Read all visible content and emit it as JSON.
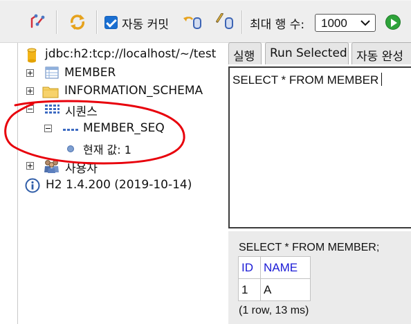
{
  "toolbar": {
    "icons": [
      "plug-icon",
      "refresh-icon",
      "rollback-icon",
      "commit-icon",
      "run-icon"
    ],
    "autocommit_label": "자동 커밋",
    "autocommit_checked": true,
    "max_rows_label": "최대 행 수:",
    "max_rows_value": "1000"
  },
  "tree": {
    "connection": "jdbc:h2:tcp://localhost/~/test",
    "items": [
      {
        "label": "MEMBER",
        "icon": "table-icon",
        "expander": "plus"
      },
      {
        "label": "INFORMATION_SCHEMA",
        "icon": "folder-icon",
        "expander": "plus"
      },
      {
        "label": "시퀀스",
        "icon": "sequences-icon",
        "expander": "minus"
      },
      {
        "label": "MEMBER_SEQ",
        "icon": "sequence-icon",
        "expander": "minus"
      },
      {
        "label": "현재 값: 1",
        "icon": "bullet-icon"
      },
      {
        "label": "사용자",
        "icon": "users-icon",
        "expander": "plus"
      }
    ],
    "version": "H2 1.4.200 (2019-10-14)"
  },
  "annotation_color": "#e8000b",
  "tabs": [
    "실행",
    "Run Selected",
    "자동 완성"
  ],
  "editor": {
    "sql": "SELECT * FROM MEMBER"
  },
  "result": {
    "sql": "SELECT * FROM MEMBER;",
    "columns": [
      "ID",
      "NAME"
    ],
    "rows": [
      [
        "1",
        "A"
      ]
    ],
    "meta": "(1 row, 13 ms)"
  }
}
